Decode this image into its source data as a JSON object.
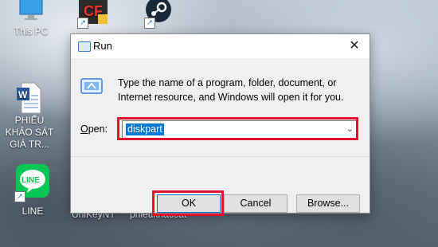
{
  "desktop": {
    "icons": [
      {
        "label": "This PC",
        "icon": "computer-icon"
      },
      {
        "label": "",
        "icon": "game-app-icon"
      },
      {
        "label": "",
        "icon": "steam-icon"
      },
      {
        "label": "PHIẾU KHẢO SÁT GIÁ TR...",
        "icon": "word-document-icon"
      },
      {
        "label": "LINE",
        "icon": "line-app-icon"
      },
      {
        "label": "UniKeyNT",
        "icon": ""
      },
      {
        "label": "phieukhaosat",
        "icon": ""
      }
    ],
    "line_badge": "LINE"
  },
  "dialog": {
    "title": "Run",
    "description": "Type the name of a program, folder, document, or Internet resource, and Windows will open it for you.",
    "open_label_underline": "O",
    "open_label_rest": "pen:",
    "input_value": "diskpart",
    "buttons": {
      "ok": "OK",
      "cancel": "Cancel",
      "browse": "Browse..."
    },
    "close_glyph": "✕",
    "highlight_color": "#e0102f"
  }
}
